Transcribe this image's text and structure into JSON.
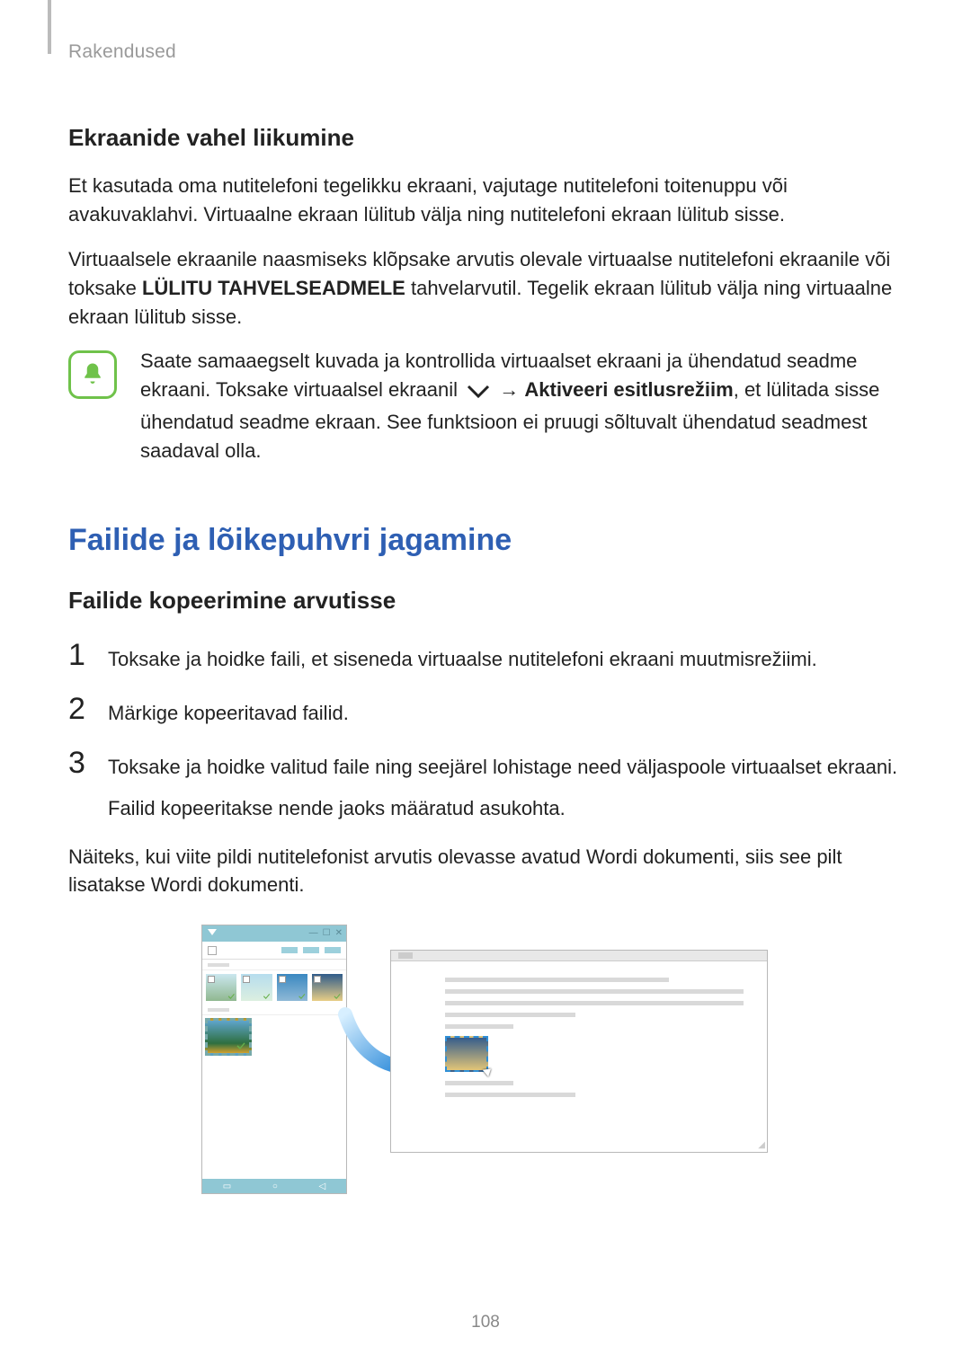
{
  "header": {
    "section_label": "Rakendused"
  },
  "s1": {
    "heading": "Ekraanide vahel liikumine",
    "p1": "Et kasutada oma nutitelefoni tegelikku ekraani, vajutage nutitelefoni toitenuppu või avakuvaklahvi. Virtuaalne ekraan lülitub välja ning nutitelefoni ekraan lülitub sisse.",
    "p2a": "Virtuaalsele ekraanile naasmiseks klõpsake arvutis olevale virtuaalse nutitelefoni ekraanile või toksake ",
    "p2_bold": "LÜLITU TAHVELSEADMELE",
    "p2b": " tahvelarvutil. Tegelik ekraan lülitub välja ning virtuaalne ekraan lülitub sisse."
  },
  "note": {
    "line1": "Saate samaaegselt kuvada ja kontrollida virtuaalset ekraani ja ühendatud seadme ekraani. Toksake virtuaalsel ekraanil ",
    "arrow": "→",
    "bold": "Aktiveeri esitlusrežiim",
    "line2": ", et lülitada sisse ühendatud seadme ekraan. See funktsioon ei pruugi sõltuvalt ühendatud seadmest saadaval olla."
  },
  "s2": {
    "title": "Failide ja lõikepuhvri jagamine",
    "subheading": "Failide kopeerimine arvutisse",
    "steps": [
      {
        "num": "1",
        "text": "Toksake ja hoidke faili, et siseneda virtuaalse nutitelefoni ekraani muutmisrežiimi."
      },
      {
        "num": "2",
        "text": "Märkige kopeeritavad failid."
      },
      {
        "num": "3",
        "text": "Toksake ja hoidke valitud faile ning seejärel lohistage need väljaspoole virtuaalset ekraani.",
        "sub": "Failid kopeeritakse nende jaoks määratud asukohta."
      }
    ],
    "after": "Näiteks, kui viite pildi nutitelefonist arvutis olevasse avatud Wordi dokumenti, siis see pilt lisatakse Wordi dokumenti."
  },
  "page_number": "108"
}
